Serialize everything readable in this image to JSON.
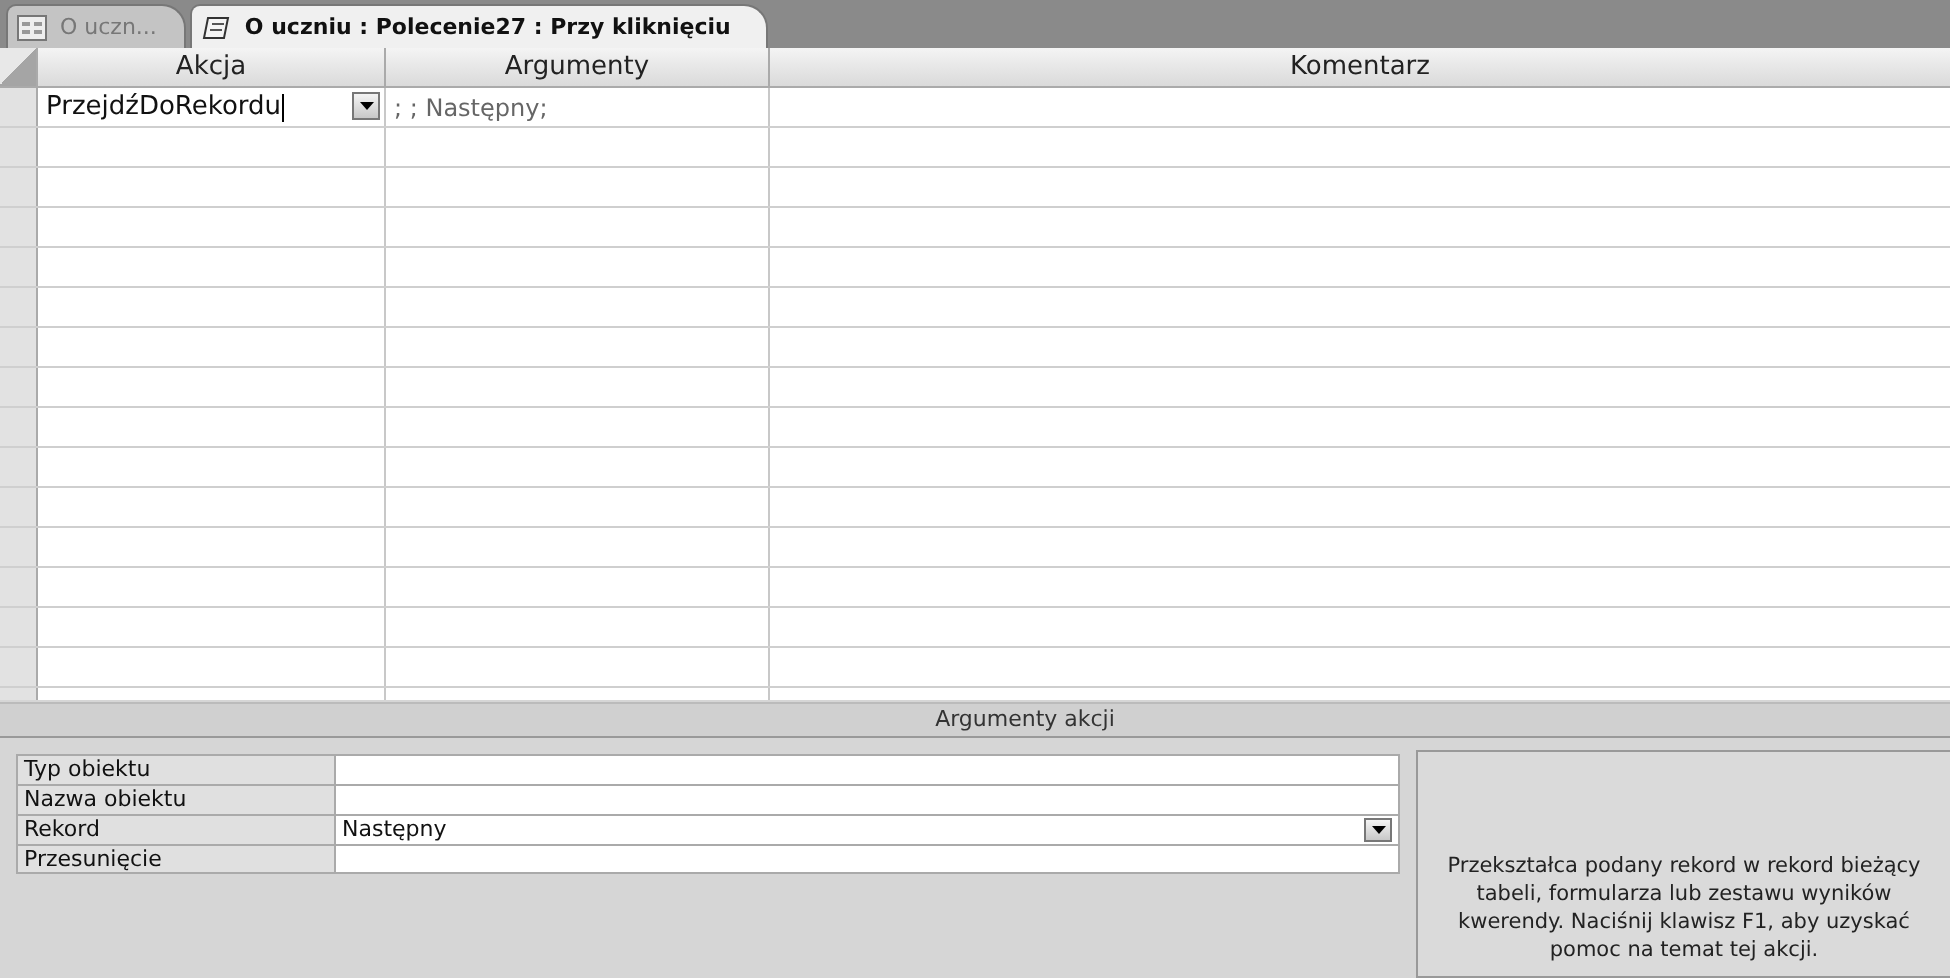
{
  "tabs": [
    {
      "label": "O uczn...",
      "selected": false,
      "kind": "form"
    },
    {
      "label": "O uczniu : Polecenie27 : Przy kliknięciu",
      "selected": true,
      "kind": "macro"
    }
  ],
  "grid": {
    "columns": [
      "Akcja",
      "Argumenty",
      "Komentarz"
    ],
    "rows": [
      {
        "action": "PrzejdźDoRekordu",
        "arguments": "; ; Następny;",
        "selected": true
      }
    ]
  },
  "arguments_panel": {
    "title": "Argumenty akcji",
    "properties": [
      {
        "label": "Typ obiektu",
        "kind": "text"
      },
      {
        "label": "Nazwa obiektu",
        "kind": "text"
      },
      {
        "label": "Rekord",
        "value": "Następny",
        "kind": "dropdown"
      },
      {
        "label": "Przesunięcie",
        "kind": "text"
      }
    ],
    "help": "Przekształca podany rekord w rekord bieżący tabeli, formularza lub zestawu wyników kwerendy. Naciśnij klawisz F1, aby uzyskać pomoc na temat tej akcji."
  }
}
